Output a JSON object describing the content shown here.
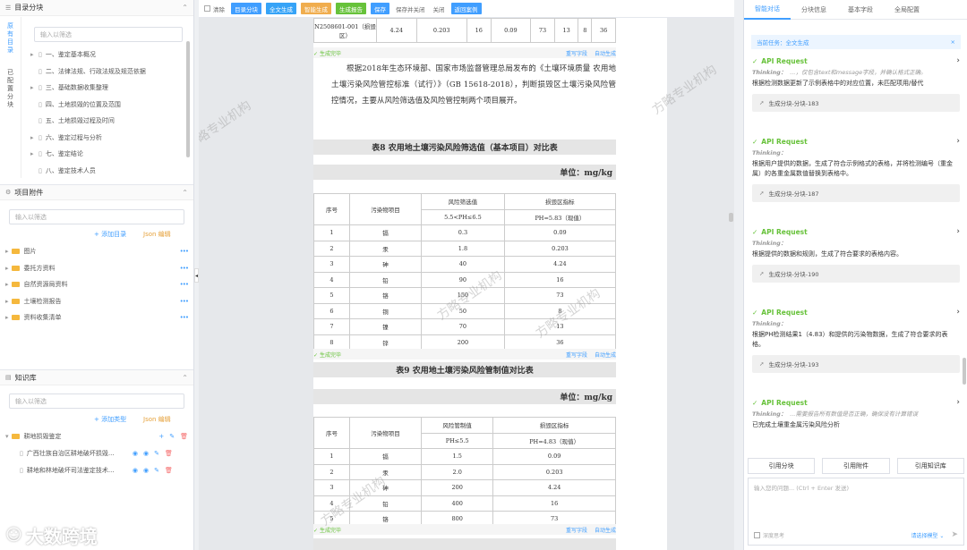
{
  "left": {
    "catalog": {
      "title": "目录分块",
      "search_ph": "输入以筛选",
      "vtab1": "原有目录",
      "vtab2": "已配置分块",
      "items": [
        "一、鉴定基本概况",
        "二、法律法规、行政法规及规范依据",
        "三、基础数据收集整理",
        "四、土地损毁的位置及范围",
        "五、土地损毁过程及时间",
        "六、鉴定过程与分析",
        "七、鉴定结论",
        "八、鉴定技术人员"
      ]
    },
    "attach": {
      "title": "项目附件",
      "search_ph": "输入以筛选",
      "add": "+ 添加目录",
      "json": "Json 编辑",
      "folders": [
        "图片",
        "委托方资料",
        "自然资源局资料",
        "土壤检测报告",
        "资料收集清单"
      ]
    },
    "kb": {
      "title": "知识库",
      "search_ph": "输入以筛选",
      "add": "+ 添加类型",
      "json": "Json 编辑",
      "folder": "耕地损毁鉴定",
      "files": [
        "广西壮族自治区耕地破坏损毁...",
        "耕地和林地破坏司法鉴定技术..."
      ]
    }
  },
  "toolbar": {
    "items": [
      "清除",
      "目录分块",
      "全文生成",
      "智能生成",
      "生成报告",
      "保存",
      "保存并关闭",
      "关闭",
      "返回案例"
    ]
  },
  "doc": {
    "top_row": [
      "N2508601-001（损毁区）",
      "4.24",
      "0.203",
      "16",
      "0.09",
      "73",
      "13",
      "8",
      "36"
    ],
    "status": {
      "done": "生成完毕",
      "retry": "重写字段",
      "auto": "自动生成"
    },
    "para": "根据2018年生态环境部、国家市场监督管理总局发布的《土壤环境质量 农用地土壤污染风险管控标准（试行）》（GB 15618-2018），判断损毁区土壤污染风险管控情况，主要从风险筛选值及风险管控制两个项目展开。",
    "t8": {
      "title": "表8 农用地土壤污染风险筛选值（基本项目）对比表",
      "unit": "单位：mg/kg",
      "h1": [
        "序号",
        "污染物项目",
        "风险筛选值",
        "损毁区指标"
      ],
      "h2": [
        "5.5<PH≤6.5",
        "PH=5.83（现值）"
      ],
      "rows": [
        [
          "1",
          "镉",
          "0.3",
          "0.09"
        ],
        [
          "2",
          "汞",
          "1.8",
          "0.203"
        ],
        [
          "3",
          "砷",
          "40",
          "4.24"
        ],
        [
          "4",
          "铅",
          "90",
          "16"
        ],
        [
          "5",
          "铬",
          "150",
          "73"
        ],
        [
          "6",
          "铜",
          "50",
          "8"
        ],
        [
          "7",
          "镍",
          "70",
          "13"
        ],
        [
          "8",
          "锌",
          "200",
          "36"
        ]
      ]
    },
    "t9": {
      "title": "表9 农用地土壤污染风险管制值对比表",
      "unit": "单位：mg/kg",
      "h1": [
        "序号",
        "污染物项目",
        "风险管制值",
        "损毁区指标"
      ],
      "h2": [
        "PH≤5.5",
        "PH=4.83（现值）"
      ],
      "rows": [
        [
          "1",
          "镉",
          "1.5",
          "0.09"
        ],
        [
          "2",
          "汞",
          "2.0",
          "0.203"
        ],
        [
          "3",
          "砷",
          "200",
          "4.24"
        ],
        [
          "4",
          "铅",
          "400",
          "16"
        ],
        [
          "5",
          "铬",
          "800",
          "73"
        ]
      ]
    }
  },
  "right": {
    "tabs": [
      "智能对话",
      "分块信息",
      "基本字段",
      "全局配置"
    ],
    "task": "当前任务：全文生成",
    "msgs": [
      {
        "api": "API Request",
        "think": "...，仅包含text和message字段，并确认格式正确。",
        "text": "根据检测数据更新了示例表格中的对应位置，未匹配项用/替代",
        "gen": "生成分块-分块-183"
      },
      {
        "api": "API Request",
        "think": "",
        "text": "根据用户提供的数据，生成了符合示例格式的表格，并将检测编号（重金属）的各重金属数值替换到表格中。",
        "gen": "生成分块-分块-187"
      },
      {
        "api": "API Request",
        "think": "",
        "text": "根据提供的数据和规则，生成了符合要求的表格内容。",
        "gen": "生成分块-分块-190"
      },
      {
        "api": "API Request",
        "think": "",
        "text": "根据PH检测结果1（4.83）和提供的污染物数据，生成了符合要求的表格。",
        "gen": "生成分块-分块-193"
      },
      {
        "api": "API Request",
        "think": "...需要报告所有数值是否正确，确保没有计算错误",
        "text": "已完成土壤重金属污染风险分析",
        "gen": ""
      }
    ],
    "think_label": "Thinking：",
    "refs": [
      "引用分块",
      "引用附件",
      "引用知识库"
    ],
    "chat_ph": "输入您的问题... (Ctrl + Enter 发送)",
    "deep": "深度思考",
    "model": "请选择模型"
  },
  "watermark": "方略专业机构",
  "logo": "大数跨境"
}
